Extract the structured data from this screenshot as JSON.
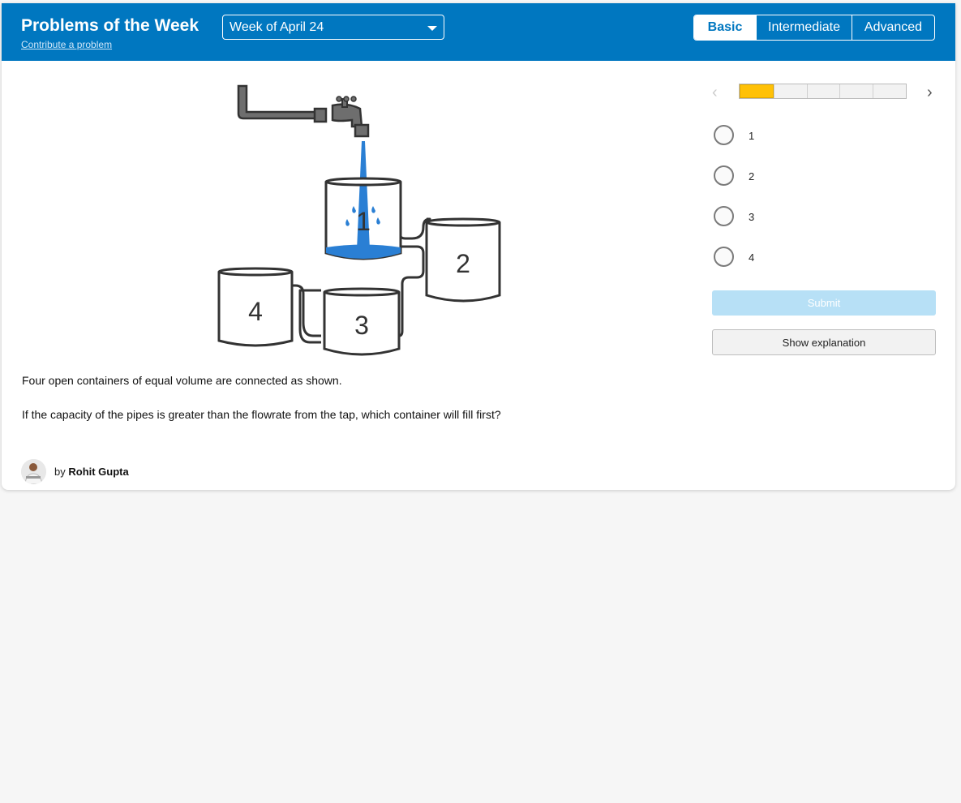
{
  "header": {
    "title": "Problems of the Week",
    "contribute_label": "Contribute a problem",
    "week_selected": "Week of April 24",
    "levels": [
      {
        "label": "Basic",
        "active": true
      },
      {
        "label": "Intermediate",
        "active": false
      },
      {
        "label": "Advanced",
        "active": false
      }
    ]
  },
  "figure": {
    "container_labels": [
      "1",
      "2",
      "3",
      "4"
    ],
    "water_color": "#2a7fd4"
  },
  "problem": {
    "paragraphs": [
      "Four open containers of equal volume are connected as shown.",
      "If the capacity of the pipes is greater than the flowrate from the tap, which container will fill first?"
    ]
  },
  "author": {
    "by": "by",
    "name": "Rohit Gupta"
  },
  "progress": {
    "completed": 1,
    "total": 5
  },
  "options": [
    "1",
    "2",
    "3",
    "4"
  ],
  "buttons": {
    "submit": "Submit",
    "explain": "Show explanation"
  },
  "colors": {
    "brand": "#0077c0",
    "progress_fill": "#ffc107",
    "submit_disabled": "#b7e0f6"
  }
}
